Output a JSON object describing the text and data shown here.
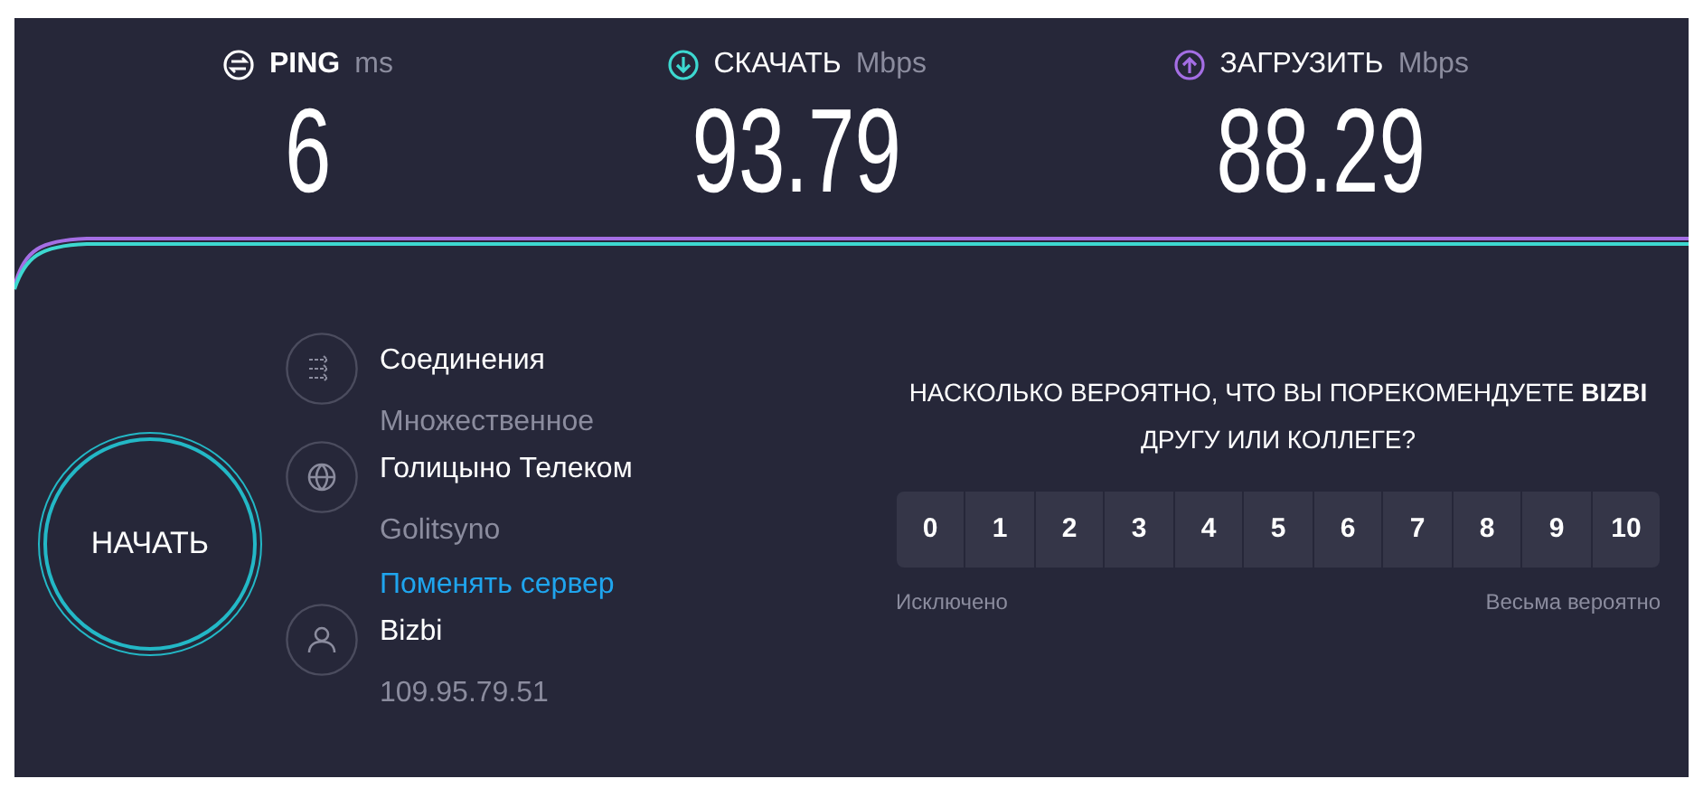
{
  "metrics": [
    {
      "kind": "ping",
      "label": "PING",
      "unit": "ms",
      "value": "6"
    },
    {
      "kind": "download",
      "label": "СКАЧАТЬ",
      "unit": "Mbps",
      "value": "93.79"
    },
    {
      "kind": "upload",
      "label": "ЗАГРУЗИТЬ",
      "unit": "Mbps",
      "value": "88.29"
    }
  ],
  "start_button": "НАЧАТЬ",
  "info": [
    {
      "kind": "connections",
      "title": "Соединения",
      "subtitle": "Множественное"
    },
    {
      "kind": "server",
      "title": "Голицыно Телеком",
      "subtitle": "Golitsyno",
      "link": "Поменять сервер"
    },
    {
      "kind": "user",
      "title": "Bizbi",
      "subtitle": "109.95.79.51"
    }
  ],
  "survey": {
    "question": "НАСКОЛЬКО ВЕРОЯТНО, ЧТО ВЫ ПОРЕКОМЕНДУЕТЕ **BIZBI** ДРУГУ ИЛИ КОЛЛЕГЕ?",
    "scale": [
      "0",
      "1",
      "2",
      "3",
      "4",
      "5",
      "6",
      "7",
      "8",
      "9",
      "10"
    ],
    "low_label": "Исключено",
    "high_label": "Весьма вероятно"
  }
}
